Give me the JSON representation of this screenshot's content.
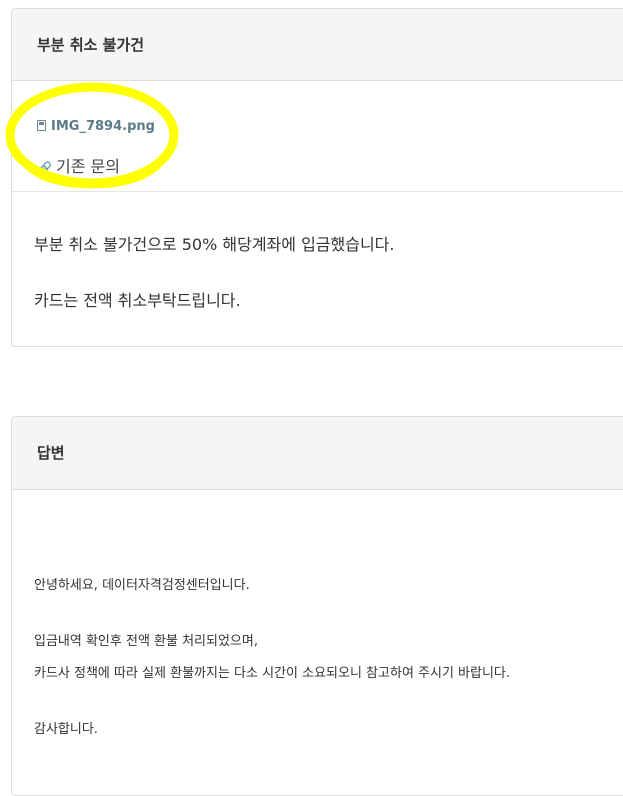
{
  "question": {
    "title": "부분 취소 불가건",
    "attachment": {
      "icon": "floppy-disk-icon",
      "filename": "IMG_7894.png"
    },
    "related": {
      "icon": "link-icon",
      "label": "기존 문의"
    },
    "body": [
      "부분 취소 불가건으로 50% 해당계좌에 입금했습니다.",
      "카드는 전액 취소부탁드립니다."
    ],
    "highlight_color": "#ffff00"
  },
  "answer": {
    "title": "답변",
    "greeting": "안녕하세요, 데이터자격검정센터입니다.",
    "line1": "입금내역 확인후 전액 환불 처리되었으며,",
    "line2": "카드사 정책에 따라 실제 환불까지는 다소 시간이 소요되오니 참고하여 주시기 바랍니다.",
    "closing": "감사합니다."
  }
}
